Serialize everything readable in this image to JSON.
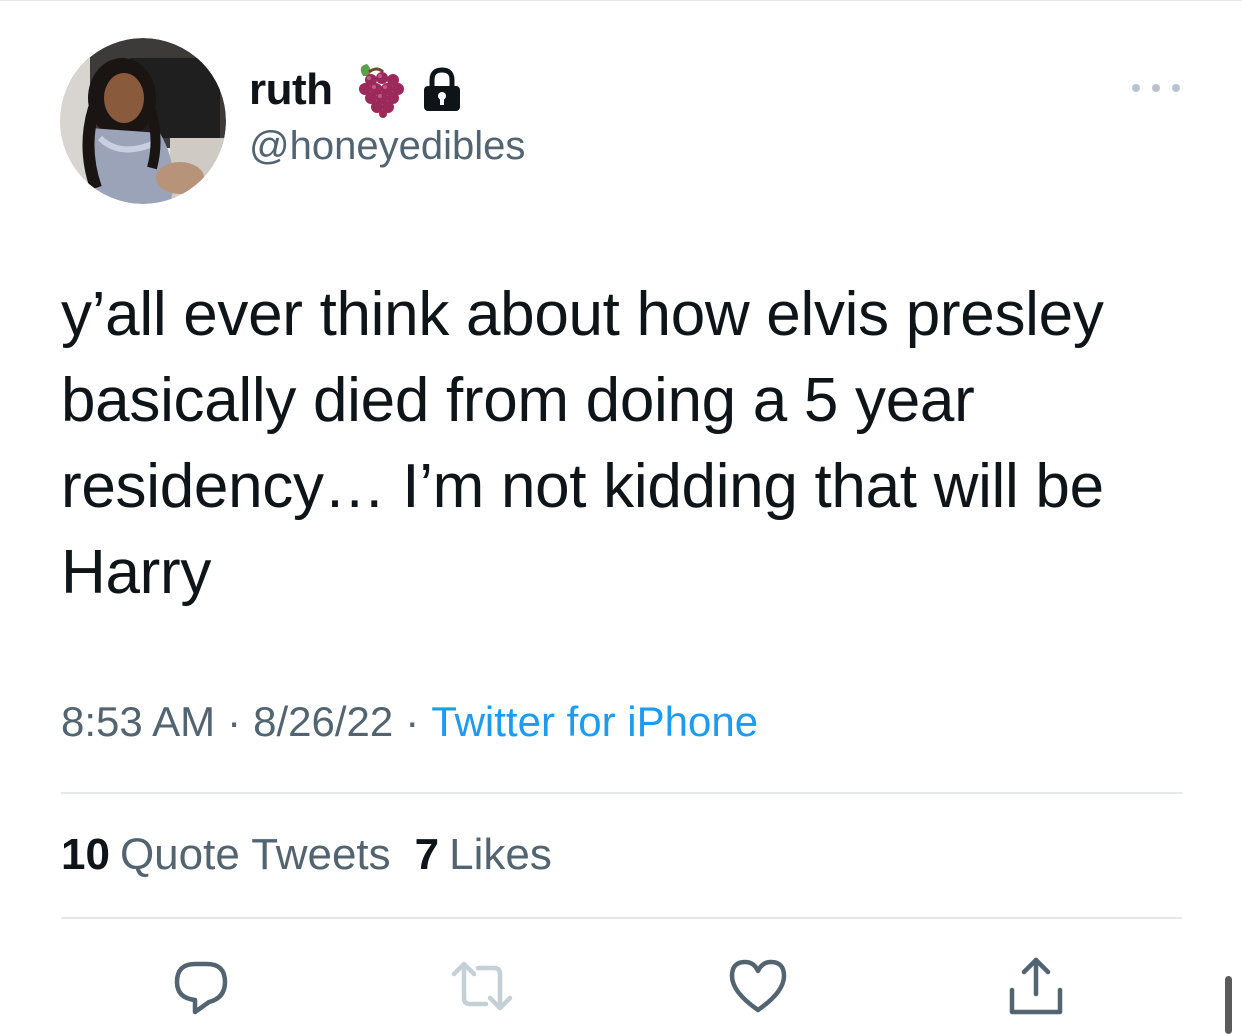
{
  "user": {
    "display_name": "ruth",
    "handle": "@honeyedibles",
    "name_emoji": "grapes-icon",
    "protected_icon": "lock-icon"
  },
  "tweet": {
    "text": "y’all ever think about how elvis presley\nbasically died from doing a 5 year\nresidency… I’m not kidding that will be\nHarry",
    "time": "8:53 AM",
    "separator": "·",
    "date": "8/26/22",
    "source": "Twitter for iPhone"
  },
  "stats": {
    "quote_tweets_count": "10",
    "quote_tweets_label": "Quote Tweets",
    "likes_count": "7",
    "likes_label": "Likes"
  },
  "actions": {
    "reply": "reply-icon",
    "retweet": "retweet-icon",
    "like": "heart-icon",
    "share": "share-icon"
  },
  "colors": {
    "text_primary": "#0f1419",
    "text_secondary": "#536471",
    "link": "#1d9bf0",
    "divider": "#e6e9eb",
    "icon_gray": "#536471",
    "retweet_disabled": "#c4cfd6",
    "grapes": "#9b2a5a"
  }
}
